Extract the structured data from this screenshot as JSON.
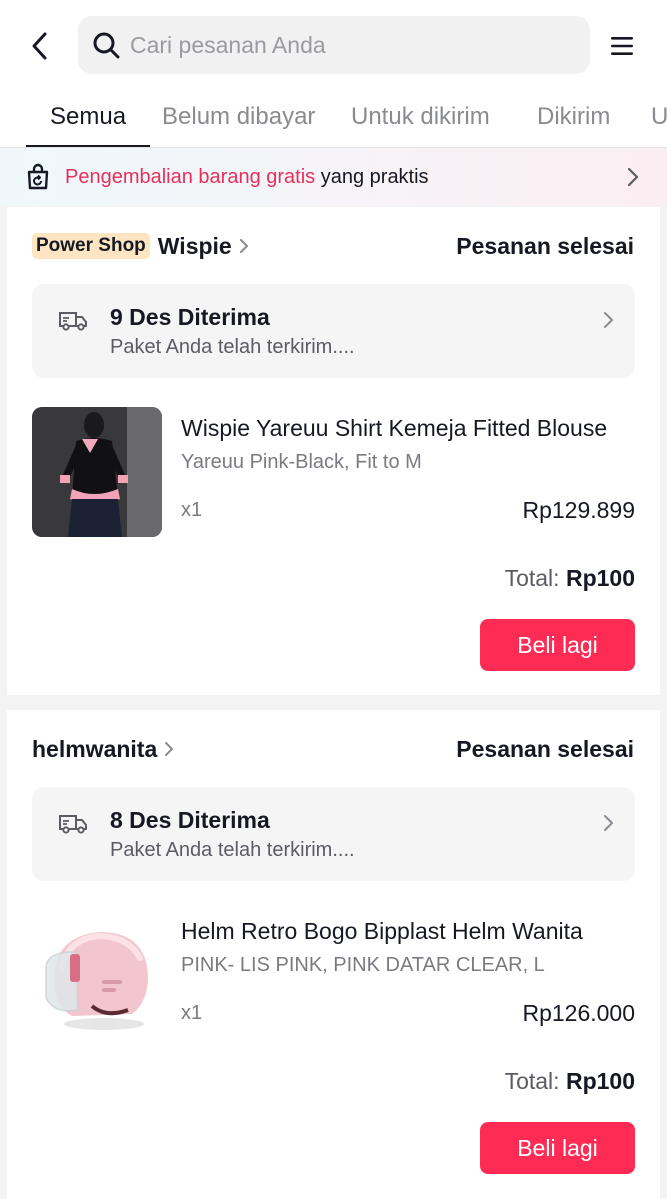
{
  "header": {
    "search_placeholder": "Cari pesanan Anda"
  },
  "tabs": [
    {
      "label": "Semua",
      "active": true
    },
    {
      "label": "Belum dibayar"
    },
    {
      "label": "Untuk dikirim"
    },
    {
      "label": "Dikirim"
    },
    {
      "label": "U"
    }
  ],
  "banner": {
    "highlight": "Pengembalian barang gratis",
    "rest": " yang praktis"
  },
  "orders": [
    {
      "badge": "Power Shop",
      "shop": "Wispie",
      "status": "Pesanan selesai",
      "ship_title": "9 Des Diterima",
      "ship_sub": "Paket Anda telah terkirim....",
      "product_name": "Wispie Yareuu Shirt Kemeja Fitted Blouse",
      "variant": "Yareuu Pink-Black, Fit to M",
      "qty": "x1",
      "price": "Rp129.899",
      "total_label": "Total: ",
      "total_value": "Rp100",
      "button": "Beli lagi"
    },
    {
      "shop": "helmwanita",
      "status": "Pesanan selesai",
      "ship_title": "8 Des Diterima",
      "ship_sub": "Paket Anda telah terkirim....",
      "product_name": "Helm Retro Bogo Bipplast Helm Wanita",
      "variant": "PINK- LIS PINK, PINK DATAR CLEAR, L",
      "qty": "x1",
      "price": "Rp126.000",
      "total_label": "Total: ",
      "total_value": "Rp100",
      "button": "Beli lagi"
    }
  ],
  "colors": {
    "accent": "#fe2c55",
    "highlight_text": "#e6305a",
    "badge_bg": "#fde5c2"
  },
  "icons": {
    "back": "chevron-left-icon",
    "search": "search-icon",
    "menu": "hamburger-menu-icon",
    "bag": "shopping-bag-return-icon",
    "truck": "delivery-truck-icon"
  }
}
